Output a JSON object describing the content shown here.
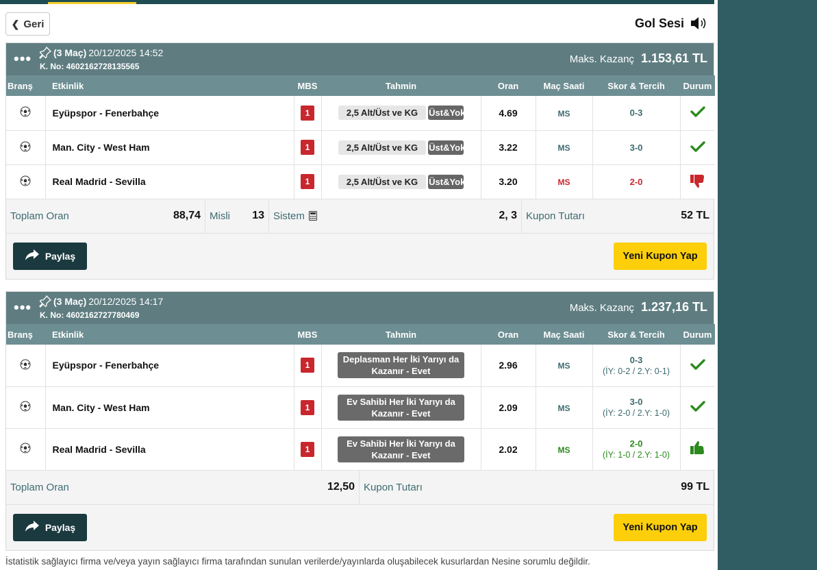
{
  "nav": {
    "back_label": "Geri",
    "sound_label": "Gol Sesi"
  },
  "columns": {
    "brans": "Branş",
    "etkinlik": "Etkinlik",
    "mbs": "MBS",
    "tahmin": "Tahmin",
    "oran": "Oran",
    "mac_saati": "Maç Saati",
    "skor": "Skor & Tercih",
    "durum": "Durum"
  },
  "coupons": [
    {
      "count_label": "(3 Maç)",
      "datetime": "20/12/2025 14:52",
      "kno": "K. No: 4602162728135565",
      "maks_label": "Maks. Kazanç",
      "maks_value": "1.153,61 TL",
      "rows": [
        {
          "event": "Eyüpspor - Fenerbahçe",
          "mbs": "1",
          "pick": "2,5 Alt/Üst ve KG",
          "tag": "Üst&Yok",
          "odd": "4.69",
          "time": "MS",
          "score": "0-3",
          "status": "won"
        },
        {
          "event": "Man. City - West Ham",
          "mbs": "1",
          "pick": "2,5 Alt/Üst ve KG",
          "tag": "Üst&Yok",
          "odd": "3.22",
          "time": "MS",
          "score": "3-0",
          "status": "won"
        },
        {
          "event": "Real Madrid - Sevilla",
          "mbs": "1",
          "pick": "2,5 Alt/Üst ve KG",
          "tag": "Üst&Yok",
          "odd": "3.20",
          "time": "MS",
          "score": "2-0",
          "status": "lost"
        }
      ],
      "summary": {
        "toplam_label": "Toplam Oran",
        "toplam_value": "88,74",
        "misli_label": "Misli",
        "misli_value": "13",
        "sistem_label": "Sistem",
        "sistem_value": "2, 3",
        "tutar_label": "Kupon Tutarı",
        "tutar_value": "52 TL"
      },
      "share_label": "Paylaş",
      "new_label": "Yeni Kupon Yap"
    },
    {
      "count_label": "(3 Maç)",
      "datetime": "20/12/2025 14:17",
      "kno": "K. No: 4602162727780469",
      "maks_label": "Maks. Kazanç",
      "maks_value": "1.237,16 TL",
      "rows": [
        {
          "event": "Eyüpspor - Fenerbahçe",
          "mbs": "1",
          "pick": "Deplasman Her İki Yarıyı da Kazanır - Evet",
          "odd": "2.96",
          "time": "MS",
          "score": "0-3",
          "score_sub": "(İY: 0-2 / 2.Y: 0-1)",
          "status": "won"
        },
        {
          "event": "Man. City - West Ham",
          "mbs": "1",
          "pick": "Ev Sahibi Her İki Yarıyı da Kazanır - Evet",
          "odd": "2.09",
          "time": "MS",
          "score": "3-0",
          "score_sub": "(İY: 2-0 / 2.Y: 1-0)",
          "status": "won"
        },
        {
          "event": "Real Madrid - Sevilla",
          "mbs": "1",
          "pick": "Ev Sahibi Her İki Yarıyı da Kazanır - Evet",
          "odd": "2.02",
          "time": "MS",
          "score": "2-0",
          "score_sub": "(İY: 1-0 / 2.Y: 1-0)",
          "status": "thumb-up"
        }
      ],
      "summary": {
        "toplam_label": "Toplam Oran",
        "toplam_value": "12,50",
        "tutar_label": "Kupon Tutarı",
        "tutar_value": "99 TL"
      },
      "share_label": "Paylaş",
      "new_label": "Yeni Kupon Yap"
    }
  ],
  "disclaimer": "İstatistik sağlayıcı firma ve/veya yayın sağlayıcı firma tarafından sunulan verilerde/yayınlarda oluşabilecek kusurlardan Nesine sorumlu değildir.",
  "icons": {
    "sport": "football-icon",
    "won": "check-icon",
    "lost": "thumbs-down-icon",
    "thumb-up": "thumbs-up-icon"
  },
  "colors": {
    "header": "#5f7d81",
    "table_head": "#6d8e92",
    "mbs": "#c8272d",
    "accent": "#fccf0a",
    "share": "#1b3a3f",
    "rail": "#2f5d63"
  }
}
